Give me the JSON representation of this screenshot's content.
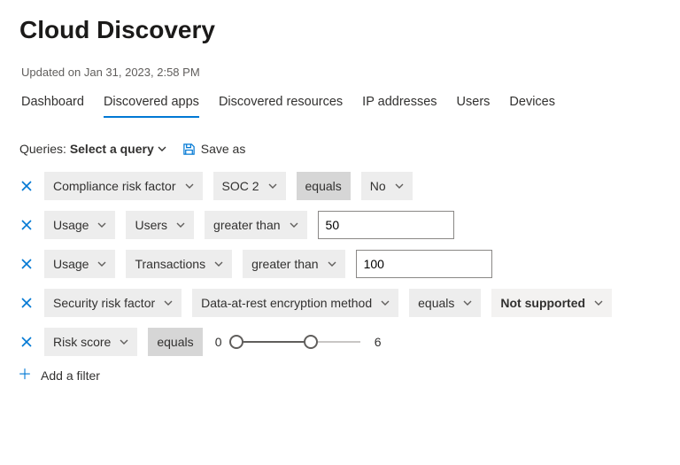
{
  "page_title": "Cloud Discovery",
  "updated_text": "Updated on Jan 31, 2023, 2:58 PM",
  "tabs": [
    "Dashboard",
    "Discovered apps",
    "Discovered resources",
    "IP addresses",
    "Users",
    "Devices"
  ],
  "active_tab_index": 1,
  "queries": {
    "label": "Queries:",
    "select_label": "Select a query",
    "save_as_label": "Save as"
  },
  "filters": [
    {
      "field": "Compliance risk factor",
      "subfield": "SOC 2",
      "operator": "equals",
      "operator_style": "darker",
      "value_kind": "pill",
      "value": "No"
    },
    {
      "field": "Usage",
      "subfield": "Users",
      "operator": "greater than",
      "operator_style": "normal",
      "value_kind": "input",
      "value": "50"
    },
    {
      "field": "Usage",
      "subfield": "Transactions",
      "operator": "greater than",
      "operator_style": "normal",
      "value_kind": "input",
      "value": "100"
    },
    {
      "field": "Security risk factor",
      "subfield": "Data-at-rest encryption method",
      "operator": "equals",
      "operator_style": "normal",
      "value_kind": "pill-bold",
      "value": "Not supported"
    },
    {
      "field": "Risk score",
      "operator": "equals",
      "operator_style": "darker",
      "value_kind": "range",
      "range": {
        "min": 0,
        "max": 10,
        "low": 0,
        "high": 6
      }
    }
  ],
  "add_filter_label": "Add a filter"
}
